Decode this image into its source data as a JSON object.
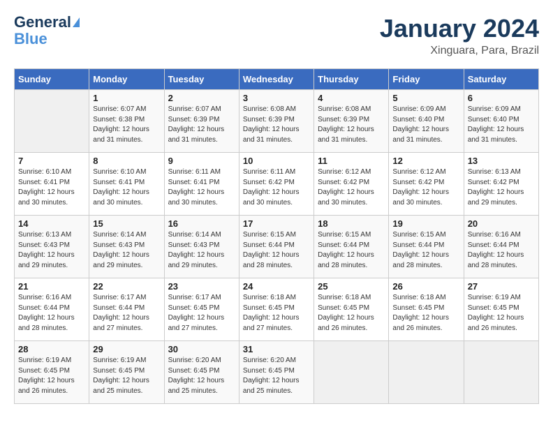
{
  "header": {
    "logo_line1": "General",
    "logo_line2": "Blue",
    "month": "January 2024",
    "location": "Xinguara, Para, Brazil"
  },
  "weekdays": [
    "Sunday",
    "Monday",
    "Tuesday",
    "Wednesday",
    "Thursday",
    "Friday",
    "Saturday"
  ],
  "weeks": [
    [
      {
        "day": "",
        "info": ""
      },
      {
        "day": "1",
        "info": "Sunrise: 6:07 AM\nSunset: 6:38 PM\nDaylight: 12 hours\nand 31 minutes."
      },
      {
        "day": "2",
        "info": "Sunrise: 6:07 AM\nSunset: 6:39 PM\nDaylight: 12 hours\nand 31 minutes."
      },
      {
        "day": "3",
        "info": "Sunrise: 6:08 AM\nSunset: 6:39 PM\nDaylight: 12 hours\nand 31 minutes."
      },
      {
        "day": "4",
        "info": "Sunrise: 6:08 AM\nSunset: 6:39 PM\nDaylight: 12 hours\nand 31 minutes."
      },
      {
        "day": "5",
        "info": "Sunrise: 6:09 AM\nSunset: 6:40 PM\nDaylight: 12 hours\nand 31 minutes."
      },
      {
        "day": "6",
        "info": "Sunrise: 6:09 AM\nSunset: 6:40 PM\nDaylight: 12 hours\nand 31 minutes."
      }
    ],
    [
      {
        "day": "7",
        "info": "Sunrise: 6:10 AM\nSunset: 6:41 PM\nDaylight: 12 hours\nand 30 minutes."
      },
      {
        "day": "8",
        "info": "Sunrise: 6:10 AM\nSunset: 6:41 PM\nDaylight: 12 hours\nand 30 minutes."
      },
      {
        "day": "9",
        "info": "Sunrise: 6:11 AM\nSunset: 6:41 PM\nDaylight: 12 hours\nand 30 minutes."
      },
      {
        "day": "10",
        "info": "Sunrise: 6:11 AM\nSunset: 6:42 PM\nDaylight: 12 hours\nand 30 minutes."
      },
      {
        "day": "11",
        "info": "Sunrise: 6:12 AM\nSunset: 6:42 PM\nDaylight: 12 hours\nand 30 minutes."
      },
      {
        "day": "12",
        "info": "Sunrise: 6:12 AM\nSunset: 6:42 PM\nDaylight: 12 hours\nand 30 minutes."
      },
      {
        "day": "13",
        "info": "Sunrise: 6:13 AM\nSunset: 6:42 PM\nDaylight: 12 hours\nand 29 minutes."
      }
    ],
    [
      {
        "day": "14",
        "info": "Sunrise: 6:13 AM\nSunset: 6:43 PM\nDaylight: 12 hours\nand 29 minutes."
      },
      {
        "day": "15",
        "info": "Sunrise: 6:14 AM\nSunset: 6:43 PM\nDaylight: 12 hours\nand 29 minutes."
      },
      {
        "day": "16",
        "info": "Sunrise: 6:14 AM\nSunset: 6:43 PM\nDaylight: 12 hours\nand 29 minutes."
      },
      {
        "day": "17",
        "info": "Sunrise: 6:15 AM\nSunset: 6:44 PM\nDaylight: 12 hours\nand 28 minutes."
      },
      {
        "day": "18",
        "info": "Sunrise: 6:15 AM\nSunset: 6:44 PM\nDaylight: 12 hours\nand 28 minutes."
      },
      {
        "day": "19",
        "info": "Sunrise: 6:15 AM\nSunset: 6:44 PM\nDaylight: 12 hours\nand 28 minutes."
      },
      {
        "day": "20",
        "info": "Sunrise: 6:16 AM\nSunset: 6:44 PM\nDaylight: 12 hours\nand 28 minutes."
      }
    ],
    [
      {
        "day": "21",
        "info": "Sunrise: 6:16 AM\nSunset: 6:44 PM\nDaylight: 12 hours\nand 28 minutes."
      },
      {
        "day": "22",
        "info": "Sunrise: 6:17 AM\nSunset: 6:44 PM\nDaylight: 12 hours\nand 27 minutes."
      },
      {
        "day": "23",
        "info": "Sunrise: 6:17 AM\nSunset: 6:45 PM\nDaylight: 12 hours\nand 27 minutes."
      },
      {
        "day": "24",
        "info": "Sunrise: 6:18 AM\nSunset: 6:45 PM\nDaylight: 12 hours\nand 27 minutes."
      },
      {
        "day": "25",
        "info": "Sunrise: 6:18 AM\nSunset: 6:45 PM\nDaylight: 12 hours\nand 26 minutes."
      },
      {
        "day": "26",
        "info": "Sunrise: 6:18 AM\nSunset: 6:45 PM\nDaylight: 12 hours\nand 26 minutes."
      },
      {
        "day": "27",
        "info": "Sunrise: 6:19 AM\nSunset: 6:45 PM\nDaylight: 12 hours\nand 26 minutes."
      }
    ],
    [
      {
        "day": "28",
        "info": "Sunrise: 6:19 AM\nSunset: 6:45 PM\nDaylight: 12 hours\nand 26 minutes."
      },
      {
        "day": "29",
        "info": "Sunrise: 6:19 AM\nSunset: 6:45 PM\nDaylight: 12 hours\nand 25 minutes."
      },
      {
        "day": "30",
        "info": "Sunrise: 6:20 AM\nSunset: 6:45 PM\nDaylight: 12 hours\nand 25 minutes."
      },
      {
        "day": "31",
        "info": "Sunrise: 6:20 AM\nSunset: 6:45 PM\nDaylight: 12 hours\nand 25 minutes."
      },
      {
        "day": "",
        "info": ""
      },
      {
        "day": "",
        "info": ""
      },
      {
        "day": "",
        "info": ""
      }
    ]
  ]
}
